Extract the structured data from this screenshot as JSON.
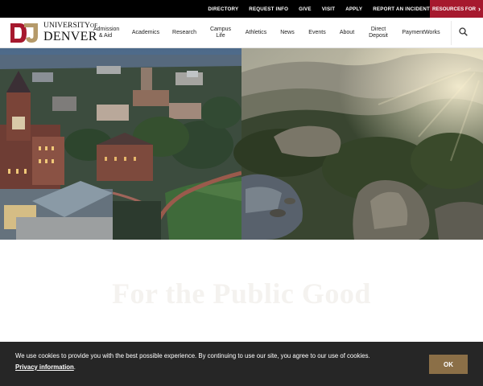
{
  "utility_bar": {
    "links": [
      "DIRECTORY",
      "REQUEST INFO",
      "GIVE",
      "VISIT",
      "APPLY",
      "REPORT AN INCIDENT"
    ],
    "resources_label": "RESOURCES FOR",
    "accent_color": "#a6192e"
  },
  "logo": {
    "line1": "UNIVERSITY",
    "line1_of": "OF",
    "line2": "DENVER"
  },
  "nav": {
    "items": [
      "Admission & Aid",
      "Academics",
      "Research",
      "Campus Life",
      "Athletics",
      "News",
      "Events",
      "About",
      "Direct Deposit",
      "PaymentWorks"
    ],
    "search_icon": "search-icon"
  },
  "hero": {
    "left_image": "campus-aerial-dusk",
    "right_image": "mountain-forest-sunset"
  },
  "content": {
    "faded_heading": "For the Public Good"
  },
  "cookie_banner": {
    "message": "We use cookies to provide you with the best possible experience. By continuing to use our site, you agree to our use of cookies.",
    "privacy_link": "Privacy information",
    "privacy_suffix": ".",
    "ok_label": "OK",
    "ok_color": "#8b6f47"
  }
}
